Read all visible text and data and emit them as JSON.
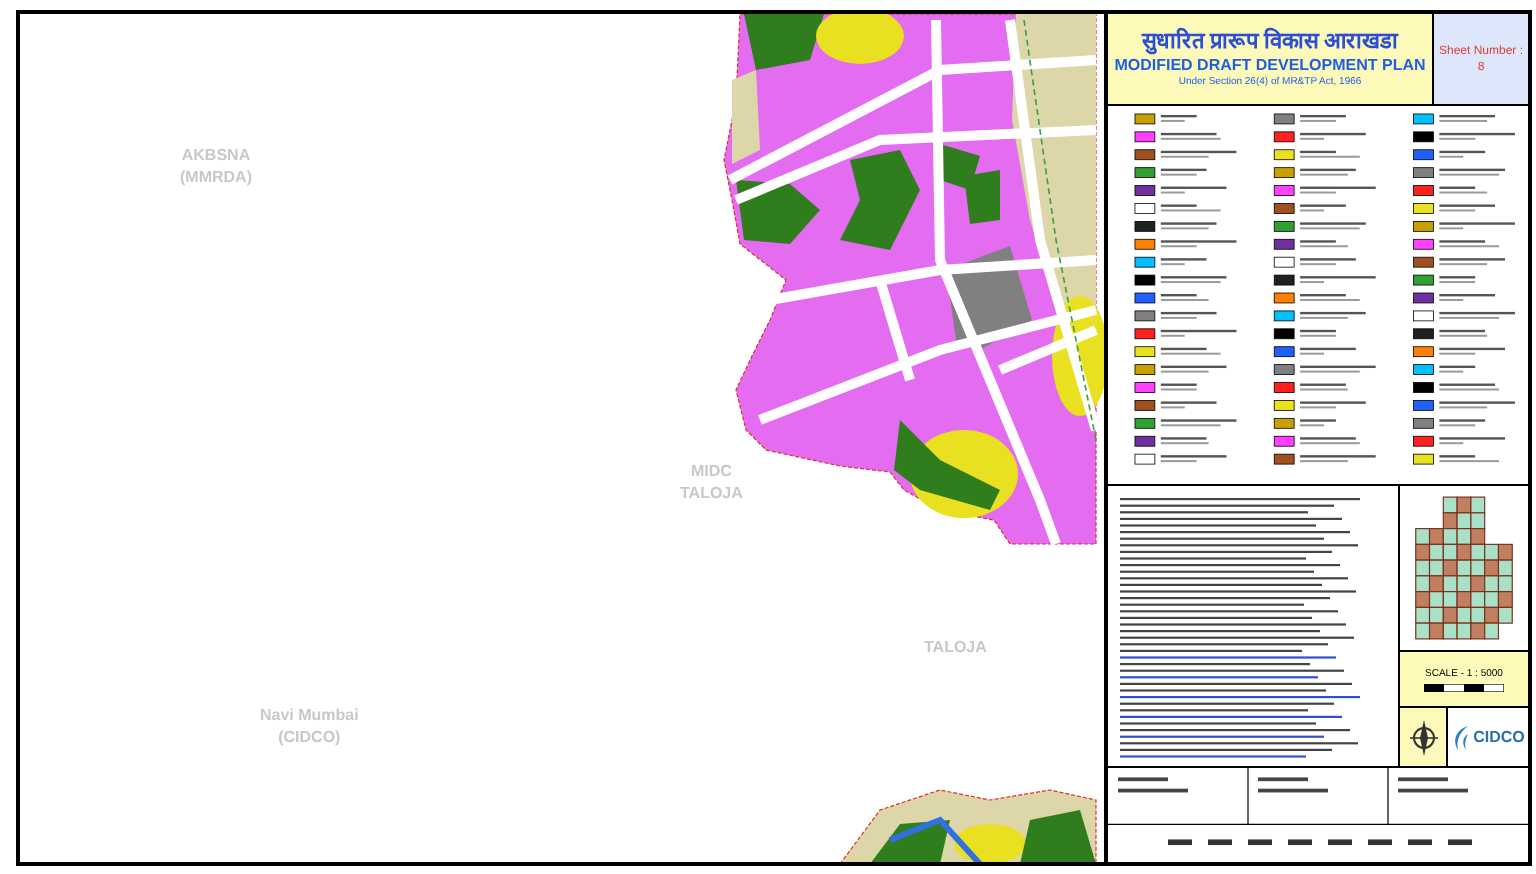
{
  "map": {
    "labels": [
      {
        "lines": [
          "AKBSNA",
          "(MMRDA)"
        ]
      },
      {
        "lines": [
          "MIDC",
          "TALOJA"
        ]
      },
      {
        "lines": [
          "TALOJA"
        ]
      },
      {
        "lines": [
          "Navi Mumbai",
          "(CIDCO)"
        ]
      }
    ]
  },
  "title_block": {
    "title_marathi": "सुधारित प्रारूप विकास आराखडा",
    "title": "MODIFIED DRAFT DEVELOPMENT PLAN",
    "subtitle": "Under Section 26(4) of MR&TP Act, 1966",
    "sheet_number": "Sheet Number : 8"
  },
  "scale": {
    "label": "SCALE - 1 : 5000"
  },
  "logo": {
    "text": "CIDCO"
  }
}
